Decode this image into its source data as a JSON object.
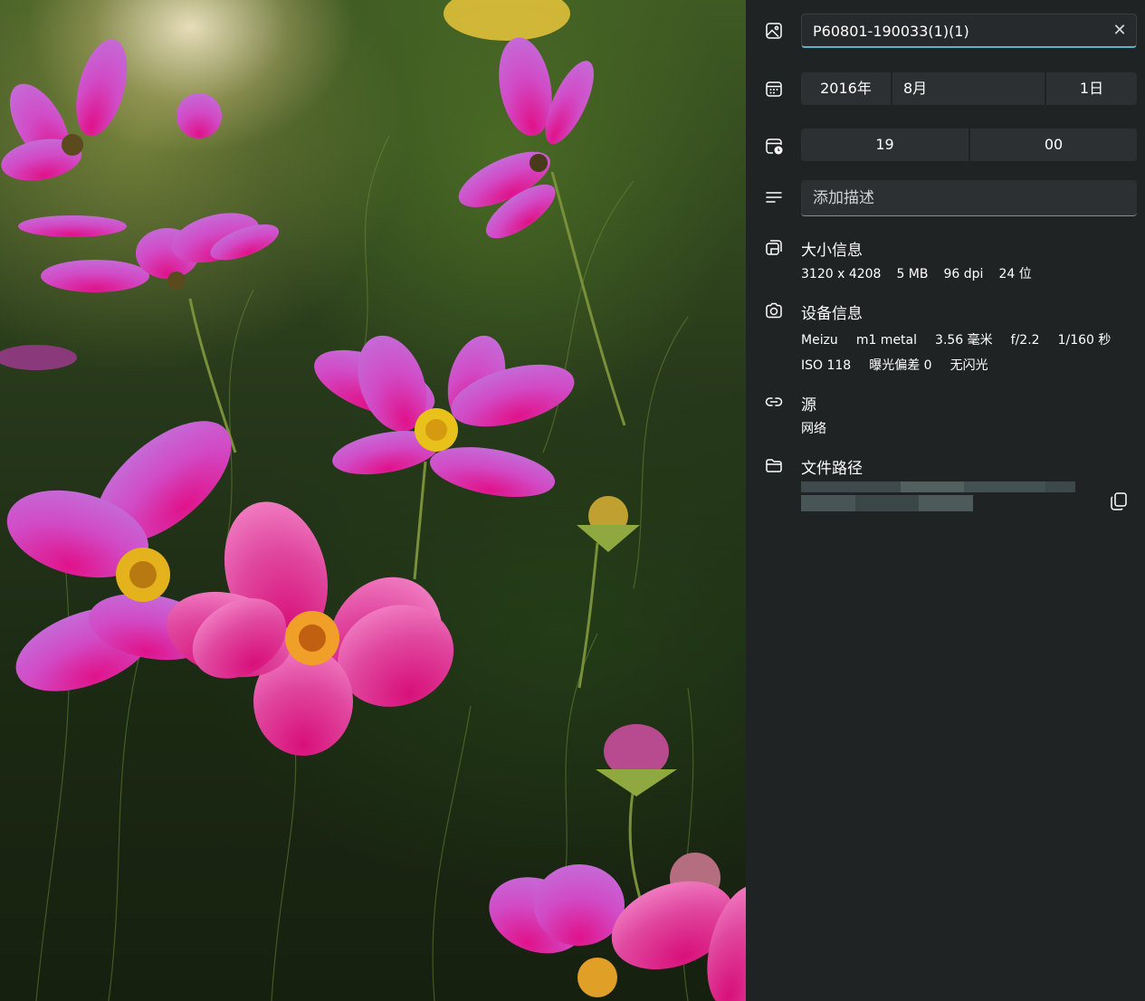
{
  "photo": {
    "description_icon": "photo-preview"
  },
  "title": {
    "value": "P60801-190033(1)(1)",
    "clear_icon": "✕"
  },
  "date": {
    "year": "2016年",
    "month": "8月",
    "day": "1日"
  },
  "time": {
    "hour": "19",
    "minute": "00"
  },
  "description": {
    "placeholder": "添加描述"
  },
  "size_info": {
    "heading": "大小信息",
    "dimensions": "3120 x 4208",
    "file_size": "5 MB",
    "dpi": "96 dpi",
    "bit_depth": "24 位"
  },
  "device_info": {
    "heading": "设备信息",
    "make": "Meizu",
    "model": "m1 metal",
    "focal_length": "3.56 毫米",
    "aperture": "f/2.2",
    "exposure_time": "1/160 秒",
    "iso": "ISO 118",
    "exposure_bias": "曝光偏差 0",
    "flash": "无闪光"
  },
  "source": {
    "heading": "源",
    "value": "网络"
  },
  "file_path": {
    "heading": "文件路径"
  },
  "colors": {
    "accent": "#5fb2c6",
    "panel_bg": "#1f2324",
    "field_bg": "#2c3032"
  }
}
